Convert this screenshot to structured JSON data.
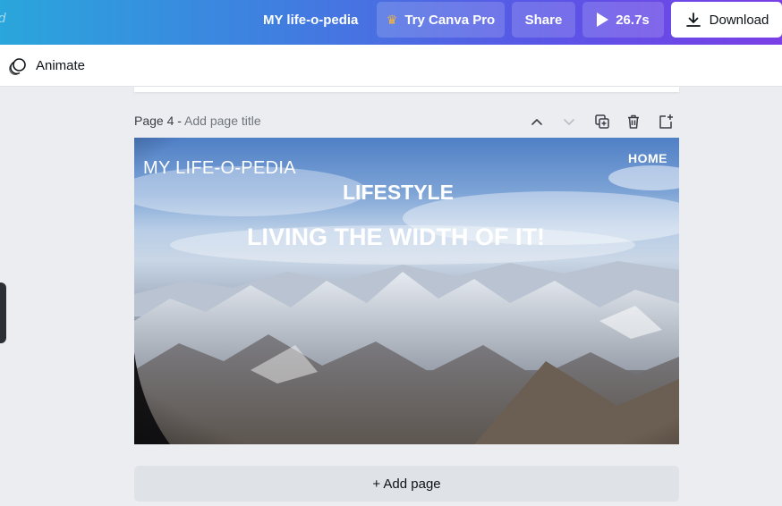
{
  "topbar": {
    "edge_glyph": "d",
    "doc_title": "MY life-o-pedia",
    "try_pro_label": "Try Canva Pro",
    "share_label": "Share",
    "duration_label": "26.7s",
    "download_label": "Download",
    "colors": {
      "gradient_start": "#2aa6dc",
      "gradient_end": "#7a3fe6"
    }
  },
  "toolbar": {
    "animate_label": "Animate"
  },
  "page": {
    "number_label": "Page 4 - ",
    "title_placeholder": "Add page title",
    "actions": [
      "chevron-up-icon",
      "chevron-down-icon",
      "duplicate-icon",
      "trash-icon",
      "add-page-icon"
    ],
    "design": {
      "brand": "MY LIFE-O-PEDIA",
      "nav_home": "HOME",
      "heading": "LIFESTYLE",
      "tagline": "LIVING THE WIDTH OF IT!"
    }
  },
  "add_page_label": "+ Add page"
}
